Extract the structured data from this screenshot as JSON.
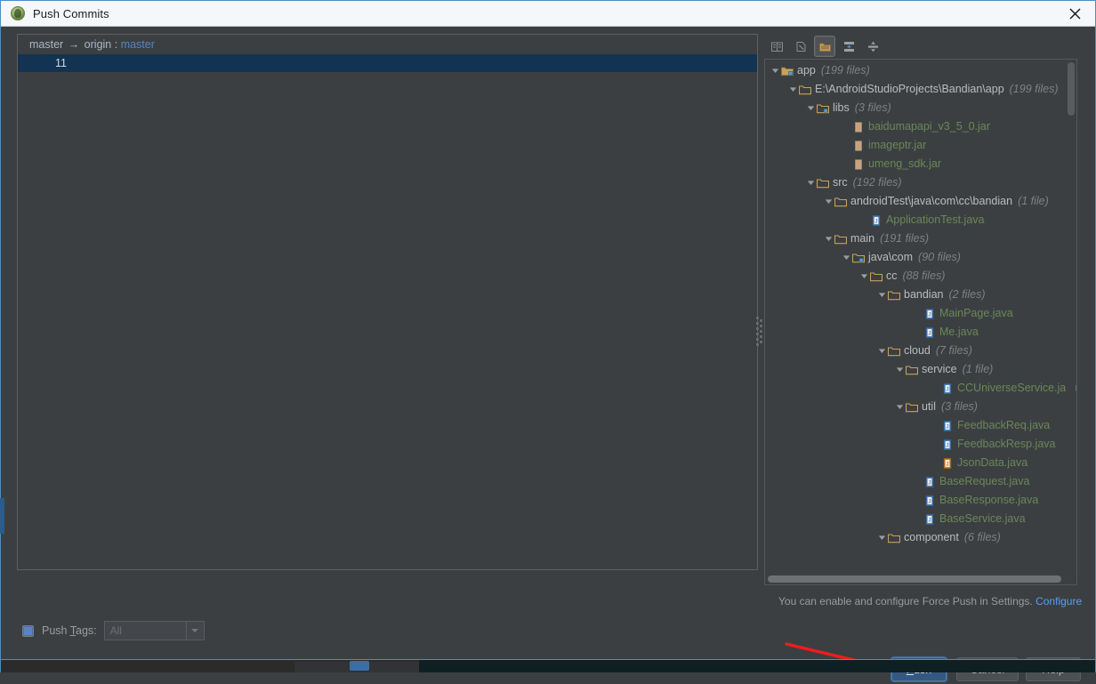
{
  "window": {
    "title": "Push Commits",
    "icon": "android-studio-icon",
    "close_icon": "close-icon"
  },
  "left_panel": {
    "branch": {
      "source": "master",
      "arrow": "→",
      "separator": "origin :",
      "target": "master"
    },
    "commits": [
      {
        "message": "11"
      }
    ]
  },
  "tree_toolbar": {
    "buttons": [
      {
        "name": "show-diff-icon",
        "label": "Show Diff",
        "active": false
      },
      {
        "name": "revert-icon",
        "label": "Revert",
        "active": false
      },
      {
        "name": "group-by-directory-icon",
        "label": "Group By Directory",
        "active": true
      },
      {
        "name": "expand-all-icon",
        "label": "Expand All",
        "active": false
      },
      {
        "name": "collapse-all-icon",
        "label": "Collapse All",
        "active": false
      }
    ]
  },
  "tree": {
    "nodes": [
      {
        "depth": 0,
        "expander": "down",
        "icon": "module-folder-icon",
        "label": "app",
        "count": "(199 files)",
        "kind": "folder"
      },
      {
        "depth": 1,
        "expander": "down",
        "icon": "folder-icon",
        "label": "E:\\AndroidStudioProjects\\Bandian\\app",
        "count": "(199 files)",
        "kind": "folder"
      },
      {
        "depth": 2,
        "expander": "down",
        "icon": "source-folder-icon",
        "label": "libs",
        "count": "(3 files)",
        "kind": "folder"
      },
      {
        "depth": 4,
        "expander": "none",
        "icon": "jar-icon",
        "label": "baidumapapi_v3_5_0.jar",
        "count": "",
        "kind": "file"
      },
      {
        "depth": 4,
        "expander": "none",
        "icon": "jar-icon",
        "label": "imageptr.jar",
        "count": "",
        "kind": "file"
      },
      {
        "depth": 4,
        "expander": "none",
        "icon": "jar-icon",
        "label": "umeng_sdk.jar",
        "count": "",
        "kind": "file"
      },
      {
        "depth": 2,
        "expander": "down",
        "icon": "folder-icon",
        "label": "src",
        "count": "(192 files)",
        "kind": "folder"
      },
      {
        "depth": 3,
        "expander": "down",
        "icon": "folder-icon",
        "label": "androidTest\\java\\com\\cc\\bandian",
        "count": "(1 file)",
        "kind": "folder"
      },
      {
        "depth": 5,
        "expander": "none",
        "icon": "java-class-icon",
        "label": "ApplicationTest.java",
        "count": "",
        "kind": "file"
      },
      {
        "depth": 3,
        "expander": "down",
        "icon": "folder-icon",
        "label": "main",
        "count": "(191 files)",
        "kind": "folder"
      },
      {
        "depth": 4,
        "expander": "down",
        "icon": "source-folder-icon",
        "label": "java\\com",
        "count": "(90 files)",
        "kind": "folder"
      },
      {
        "depth": 5,
        "expander": "down",
        "icon": "folder-icon",
        "label": "cc",
        "count": "(88 files)",
        "kind": "folder"
      },
      {
        "depth": 6,
        "expander": "down",
        "icon": "folder-icon",
        "label": "bandian",
        "count": "(2 files)",
        "kind": "folder"
      },
      {
        "depth": 8,
        "expander": "none",
        "icon": "java-class-icon",
        "label": "MainPage.java",
        "count": "",
        "kind": "file"
      },
      {
        "depth": 8,
        "expander": "none",
        "icon": "java-class-icon",
        "label": "Me.java",
        "count": "",
        "kind": "file"
      },
      {
        "depth": 6,
        "expander": "down",
        "icon": "folder-icon",
        "label": "cloud",
        "count": "(7 files)",
        "kind": "folder"
      },
      {
        "depth": 7,
        "expander": "down",
        "icon": "folder-icon",
        "label": "service",
        "count": "(1 file)",
        "kind": "folder"
      },
      {
        "depth": 9,
        "expander": "none",
        "icon": "java-class-icon",
        "label": "CCUniverseService.java",
        "count": "",
        "kind": "file"
      },
      {
        "depth": 7,
        "expander": "down",
        "icon": "folder-icon",
        "label": "util",
        "count": "(3 files)",
        "kind": "folder"
      },
      {
        "depth": 9,
        "expander": "none",
        "icon": "java-class-icon",
        "label": "FeedbackReq.java",
        "count": "",
        "kind": "file"
      },
      {
        "depth": 9,
        "expander": "none",
        "icon": "java-class-icon",
        "label": "FeedbackResp.java",
        "count": "",
        "kind": "file"
      },
      {
        "depth": 9,
        "expander": "none",
        "icon": "java-class-orange-icon",
        "label": "JsonData.java",
        "count": "",
        "kind": "file"
      },
      {
        "depth": 8,
        "expander": "none",
        "icon": "java-class-icon",
        "label": "BaseRequest.java",
        "count": "",
        "kind": "file"
      },
      {
        "depth": 8,
        "expander": "none",
        "icon": "java-class-icon",
        "label": "BaseResponse.java",
        "count": "",
        "kind": "file"
      },
      {
        "depth": 8,
        "expander": "none",
        "icon": "java-class-icon",
        "label": "BaseService.java",
        "count": "",
        "kind": "file"
      },
      {
        "depth": 6,
        "expander": "down",
        "icon": "folder-icon",
        "label": "component",
        "count": "(6 files)",
        "kind": "folder"
      }
    ]
  },
  "force_push_hint": {
    "text": "You can enable and configure Force Push in Settings.",
    "link": "Configure"
  },
  "push_tags": {
    "checkbox_name": "push-tags-checkbox",
    "checked": true,
    "label_prefix": "Push ",
    "label_underline": "T",
    "label_suffix": "ags:",
    "combo_value": "All",
    "combo_enabled": false
  },
  "buttons": {
    "push": {
      "prefix": "",
      "underline": "P",
      "suffix": "ush",
      "primary": true
    },
    "cancel": "Cancel",
    "help": "Help"
  },
  "annotation": {
    "type": "red-arrow",
    "color": "#f01c1c",
    "points_to": "push-button"
  },
  "colors": {
    "accent_blue": "#4a8ec2",
    "selection_navy": "#123352",
    "link_blue": "#589df6",
    "file_green": "#6a8759",
    "primary_button": "#365880",
    "panel_bg": "#3c3f41"
  }
}
